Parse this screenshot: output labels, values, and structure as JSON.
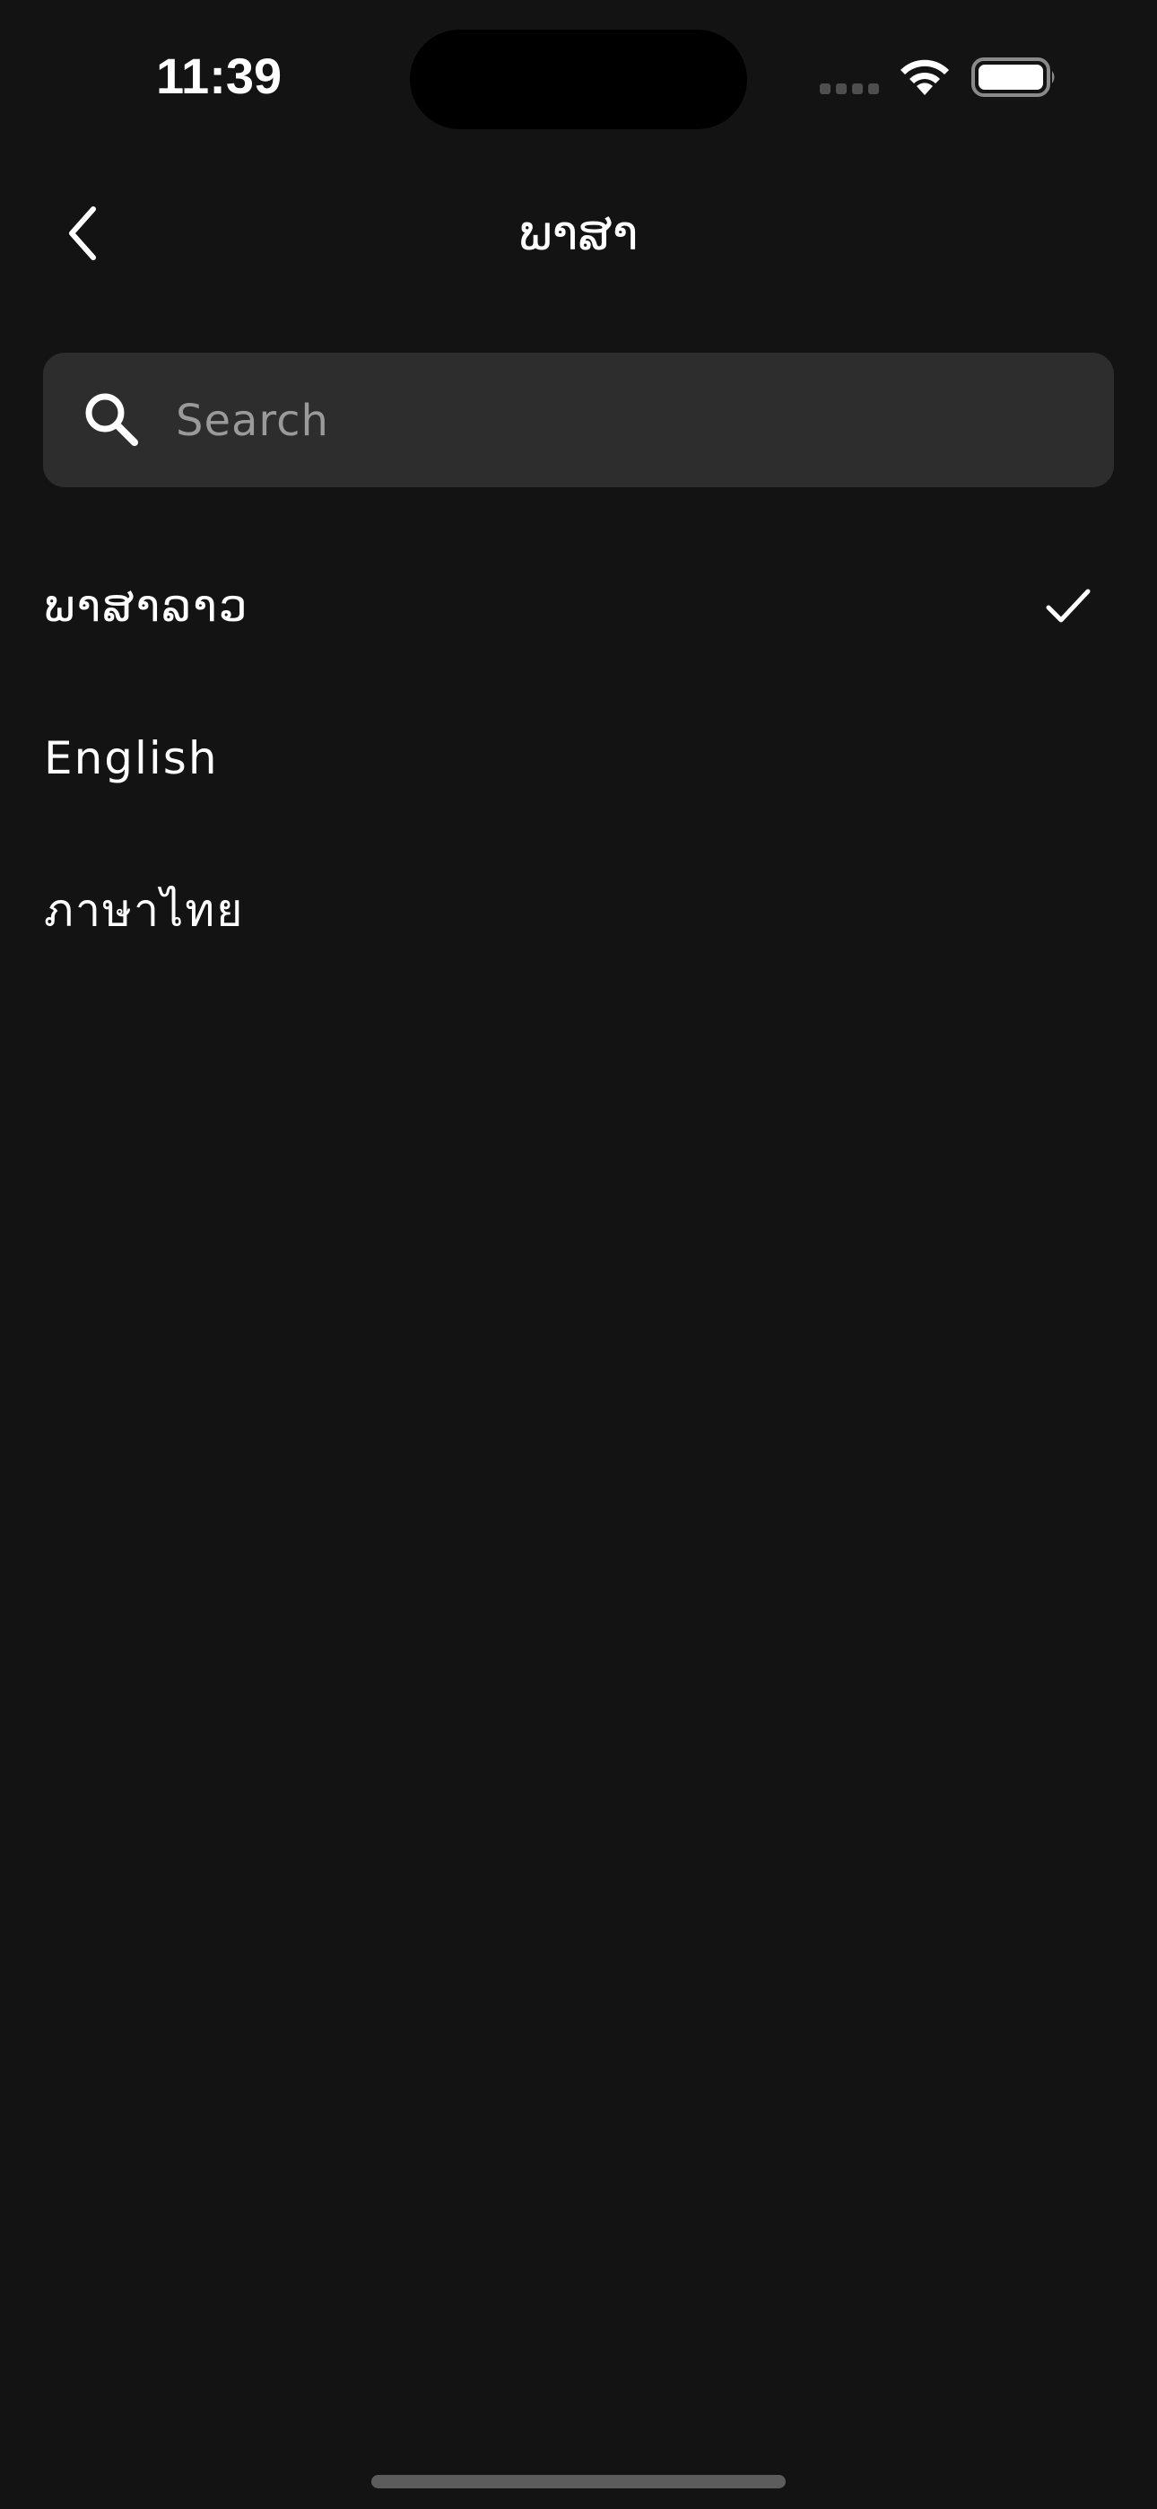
{
  "status_bar": {
    "time": "11:39"
  },
  "nav": {
    "title": "ພາສາ",
    "back_icon": "chevron-left-icon"
  },
  "search": {
    "placeholder": "Search",
    "value": "",
    "icon": "search-icon"
  },
  "languages": [
    {
      "label": "ພາສາລາວ",
      "selected": true
    },
    {
      "label": "English",
      "selected": false
    },
    {
      "label": "ภาษาไทย",
      "selected": false
    }
  ],
  "colors": {
    "background": "#131313",
    "search_background": "#2d2d2d",
    "text": "#ffffff",
    "placeholder": "#9a9a9a"
  }
}
